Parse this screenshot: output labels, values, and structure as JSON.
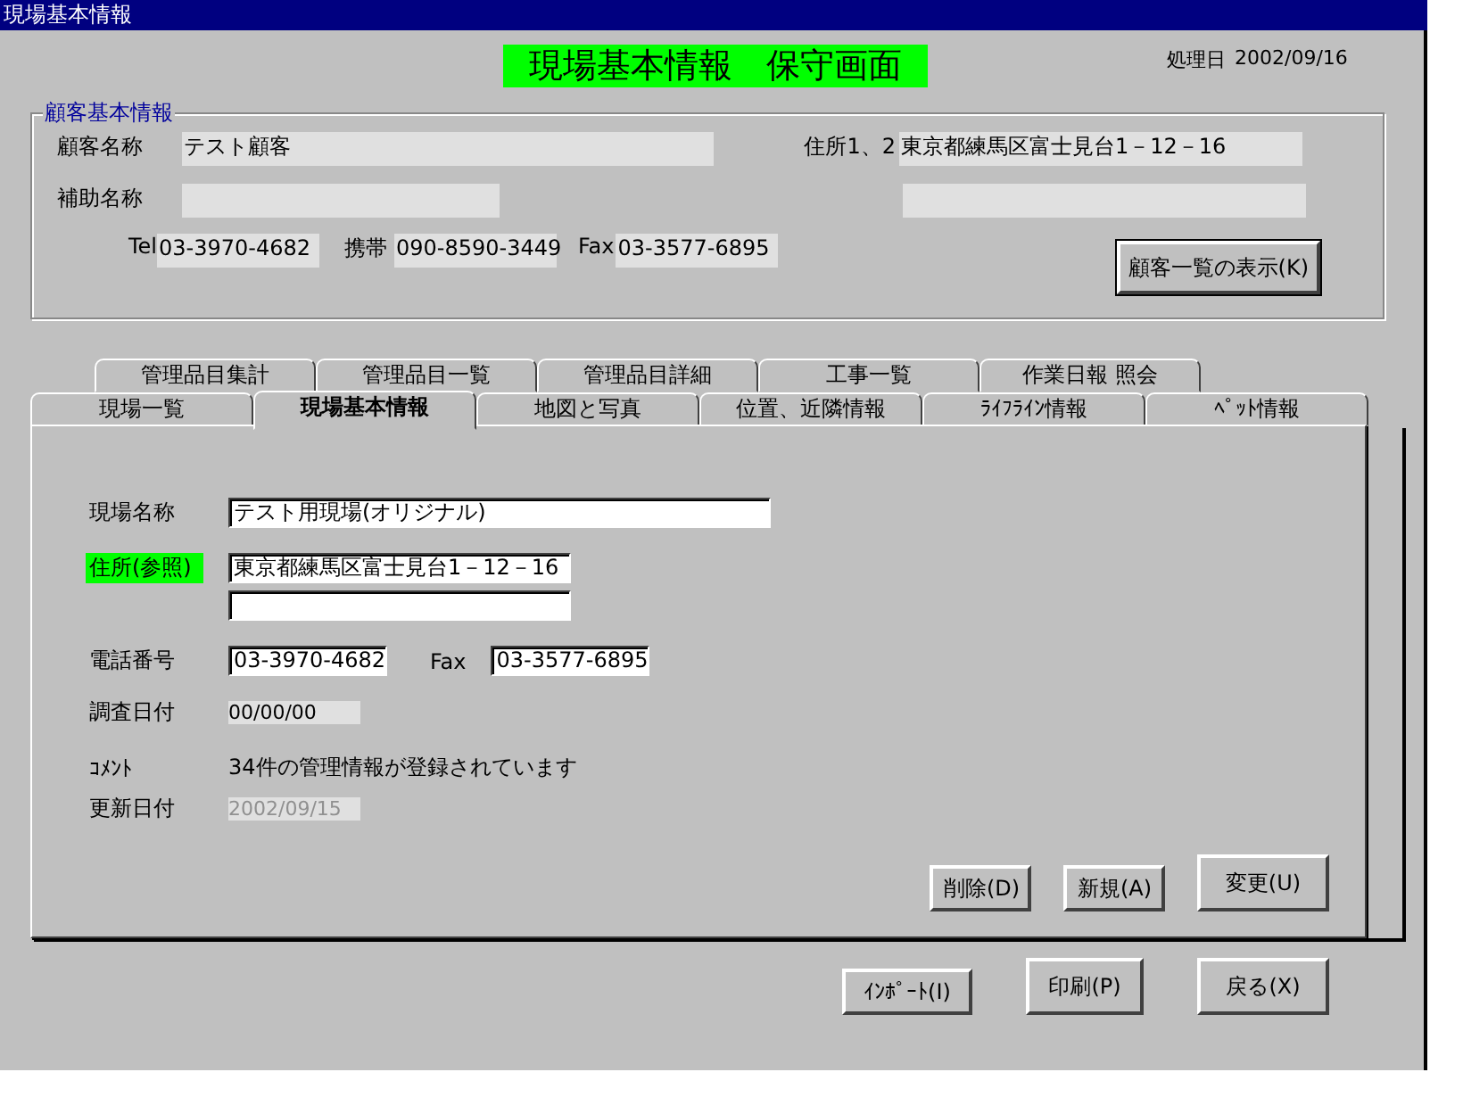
{
  "window": {
    "title": "現場基本情報"
  },
  "header": {
    "title": "現場基本情報　保守画面",
    "date_label": "処理日",
    "date": "2002/09/16"
  },
  "customer": {
    "legend": "顧客基本情報",
    "name_label": "顧客名称",
    "name": "テスト顧客",
    "address_label": "住所1、2",
    "address1": "東京都練馬区富士見台1－12－16",
    "sub_name_label": "補助名称",
    "tel_label": "Tel",
    "tel": "03-3970-4682",
    "mobile_label": "携帯",
    "mobile": "090-8590-3449",
    "fax_label": "Fax",
    "fax": "03-3577-6895",
    "button": "顧客一覧の表示(K)"
  },
  "tab_rows": [
    [
      {
        "label": "管理品目集計",
        "selected": false
      },
      {
        "label": "管理品目一覧",
        "selected": false
      },
      {
        "label": "管理品目詳細",
        "selected": false
      },
      {
        "label": "工事一覧",
        "selected": false
      },
      {
        "label": "作業日報  照会",
        "selected": false
      }
    ],
    [
      {
        "label": "現場一覧",
        "selected": false
      },
      {
        "label": "現場基本情報",
        "selected": true
      },
      {
        "label": "地図と写真",
        "selected": false
      },
      {
        "label": "位置、近隣情報",
        "selected": false
      },
      {
        "label": "ﾗｲﾌﾗｲﾝ情報",
        "selected": false
      },
      {
        "label": "ﾍﾟｯﾄ情報",
        "selected": false
      }
    ]
  ],
  "site": {
    "name_label": "現場名称",
    "name": "テスト用現場(オリジナル)",
    "address_label": "住所(参照)",
    "address_highlighted": true,
    "address": "東京都練馬区富士見台1－12－16",
    "tel_label": "電話番号",
    "tel": "03-3970-4682",
    "fax_label": "Fax",
    "fax": "03-3577-6895",
    "survey_label": "調査日付",
    "survey": "00/00/00",
    "comment_label": "ｺﾒﾝﾄ",
    "comment": "34件の管理情報が登録されています",
    "updated_label": "更新日付",
    "updated": "2002/09/15"
  },
  "panel_buttons": [
    "削除(D)",
    "新規(A)",
    "変更(U)"
  ],
  "footer_buttons": [
    "ｲﾝﾎﾟｰﾄ(I)",
    "印刷(P)",
    "戻る(X)"
  ]
}
